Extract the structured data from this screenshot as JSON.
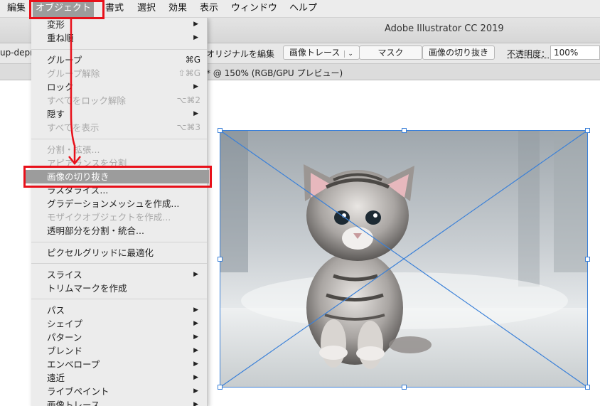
{
  "menubar": {
    "items": [
      "編集",
      "オブジェクト",
      "書式",
      "選択",
      "効果",
      "表示",
      "ウィンドウ",
      "ヘルプ"
    ]
  },
  "window": {
    "title": "Adobe Illustrator CC 2019"
  },
  "control_panel": {
    "left_fragment": "up-depr",
    "edit_original": "オリジナルを編集",
    "image_trace": "画像トレース",
    "mask": "マスク",
    "crop_image": "画像の切り抜き",
    "opacity_label": "不透明度：",
    "opacity_value": "100%"
  },
  "document_tab": {
    "title": "* @ 150% (RGB/GPU プレビュー)"
  },
  "object_menu": {
    "items": [
      {
        "label": "変形",
        "submenu": true
      },
      {
        "label": "重ね順",
        "submenu": true
      },
      {
        "label": "グループ",
        "shortcut": "⌘G"
      },
      {
        "label": "グループ解除",
        "shortcut": "⇧⌘G",
        "disabled": true
      },
      {
        "label": "ロック",
        "submenu": true
      },
      {
        "label": "すべてをロック解除",
        "shortcut": "⌥⌘2",
        "disabled": true
      },
      {
        "label": "隠す",
        "submenu": true
      },
      {
        "label": "すべてを表示",
        "shortcut": "⌥⌘3",
        "disabled": true
      },
      {
        "label": "分割・拡張...",
        "disabled": true
      },
      {
        "label": "アピアランスを分割",
        "disabled": true
      },
      {
        "label": "画像の切り抜き",
        "highlighted": true
      },
      {
        "label": "ラスタライズ..."
      },
      {
        "label": "グラデーションメッシュを作成..."
      },
      {
        "label": "モザイクオブジェクトを作成...",
        "disabled": true
      },
      {
        "label": "透明部分を分割・統合..."
      },
      {
        "label": "ピクセルグリッドに最適化"
      },
      {
        "label": "スライス",
        "submenu": true
      },
      {
        "label": "トリムマークを作成"
      },
      {
        "label": "パス",
        "submenu": true
      },
      {
        "label": "シェイプ",
        "submenu": true
      },
      {
        "label": "パターン",
        "submenu": true
      },
      {
        "label": "ブレンド",
        "submenu": true
      },
      {
        "label": "エンベロープ",
        "submenu": true
      },
      {
        "label": "遠近",
        "submenu": true
      },
      {
        "label": "ライブペイント",
        "submenu": true
      },
      {
        "label": "画像トレース",
        "submenu": true
      }
    ],
    "submenu_icon": "chevron-right-icon"
  },
  "canvas": {
    "placed_image": "kitten-photo",
    "selection_color": "#3a80d8"
  },
  "annotations": {
    "color": "#e8101a",
    "arrow_icon": "arrow-down-icon"
  },
  "colors": {
    "menu_highlight": "#9c9c9c",
    "menu_bg": "#ececec"
  }
}
